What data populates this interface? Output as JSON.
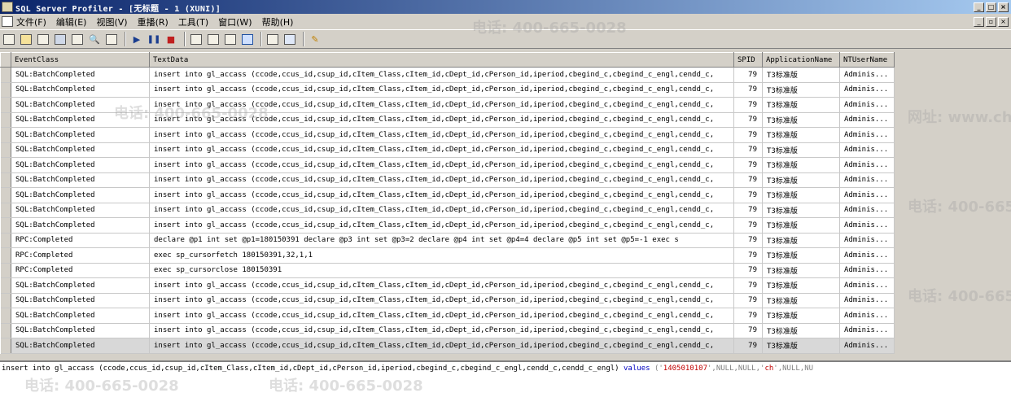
{
  "window": {
    "title": "SQL Server Profiler - [无标题 - 1 (XUNI)]"
  },
  "menu": [
    {
      "label": "文件(F)"
    },
    {
      "label": "编辑(E)"
    },
    {
      "label": "视图(V)"
    },
    {
      "label": "重播(R)"
    },
    {
      "label": "工具(T)"
    },
    {
      "label": "窗口(W)"
    },
    {
      "label": "帮助(H)"
    }
  ],
  "toolbar": {
    "buttons": [
      {
        "icon": "new-trace-icon"
      },
      {
        "icon": "open-file-icon"
      },
      {
        "icon": "open-table-icon"
      },
      {
        "icon": "save-icon"
      },
      {
        "icon": "properties-icon"
      },
      {
        "icon": "find-icon"
      },
      {
        "icon": "clear-icon"
      },
      {
        "icon": "start-icon"
      },
      {
        "icon": "pause-icon"
      },
      {
        "icon": "stop-icon"
      },
      {
        "icon": "step-icon"
      },
      {
        "icon": "run-to-cursor-icon"
      },
      {
        "icon": "toggle-bookmark-icon"
      },
      {
        "icon": "auto-scroll-icon"
      },
      {
        "icon": "activity-monitor-icon"
      },
      {
        "icon": "perfmon-icon"
      },
      {
        "icon": "help-icon"
      }
    ]
  },
  "grid": {
    "columns": [
      "EventClass",
      "TextData",
      "SPID",
      "ApplicationName",
      "NTUserName"
    ],
    "rows": [
      {
        "event": "SQL:BatchCompleted",
        "text": "insert into gl_accass (ccode,ccus_id,csup_id,cItem_Class,cItem_id,cDept_id,cPerson_id,iperiod,cbegind_c,cbegind_c_engl,cendd_c,",
        "spid": "79",
        "app": "T3标准版",
        "user": "Adminis..."
      },
      {
        "event": "SQL:BatchCompleted",
        "text": "insert into gl_accass (ccode,ccus_id,csup_id,cItem_Class,cItem_id,cDept_id,cPerson_id,iperiod,cbegind_c,cbegind_c_engl,cendd_c,",
        "spid": "79",
        "app": "T3标准版",
        "user": "Adminis..."
      },
      {
        "event": "SQL:BatchCompleted",
        "text": "insert into gl_accass (ccode,ccus_id,csup_id,cItem_Class,cItem_id,cDept_id,cPerson_id,iperiod,cbegind_c,cbegind_c_engl,cendd_c,",
        "spid": "79",
        "app": "T3标准版",
        "user": "Adminis..."
      },
      {
        "event": "SQL:BatchCompleted",
        "text": "insert into gl_accass (ccode,ccus_id,csup_id,cItem_Class,cItem_id,cDept_id,cPerson_id,iperiod,cbegind_c,cbegind_c_engl,cendd_c,",
        "spid": "79",
        "app": "T3标准版",
        "user": "Adminis..."
      },
      {
        "event": "SQL:BatchCompleted",
        "text": "insert into gl_accass (ccode,ccus_id,csup_id,cItem_Class,cItem_id,cDept_id,cPerson_id,iperiod,cbegind_c,cbegind_c_engl,cendd_c,",
        "spid": "79",
        "app": "T3标准版",
        "user": "Adminis..."
      },
      {
        "event": "SQL:BatchCompleted",
        "text": "insert into gl_accass (ccode,ccus_id,csup_id,cItem_Class,cItem_id,cDept_id,cPerson_id,iperiod,cbegind_c,cbegind_c_engl,cendd_c,",
        "spid": "79",
        "app": "T3标准版",
        "user": "Adminis..."
      },
      {
        "event": "SQL:BatchCompleted",
        "text": "insert into gl_accass (ccode,ccus_id,csup_id,cItem_Class,cItem_id,cDept_id,cPerson_id,iperiod,cbegind_c,cbegind_c_engl,cendd_c,",
        "spid": "79",
        "app": "T3标准版",
        "user": "Adminis..."
      },
      {
        "event": "SQL:BatchCompleted",
        "text": "insert into gl_accass (ccode,ccus_id,csup_id,cItem_Class,cItem_id,cDept_id,cPerson_id,iperiod,cbegind_c,cbegind_c_engl,cendd_c,",
        "spid": "79",
        "app": "T3标准版",
        "user": "Adminis..."
      },
      {
        "event": "SQL:BatchCompleted",
        "text": "insert into gl_accass (ccode,ccus_id,csup_id,cItem_Class,cItem_id,cDept_id,cPerson_id,iperiod,cbegind_c,cbegind_c_engl,cendd_c,",
        "spid": "79",
        "app": "T3标准版",
        "user": "Adminis..."
      },
      {
        "event": "SQL:BatchCompleted",
        "text": "insert into gl_accass (ccode,ccus_id,csup_id,cItem_Class,cItem_id,cDept_id,cPerson_id,iperiod,cbegind_c,cbegind_c_engl,cendd_c,",
        "spid": "79",
        "app": "T3标准版",
        "user": "Adminis..."
      },
      {
        "event": "SQL:BatchCompleted",
        "text": "insert into gl_accass (ccode,ccus_id,csup_id,cItem_Class,cItem_id,cDept_id,cPerson_id,iperiod,cbegind_c,cbegind_c_engl,cendd_c,",
        "spid": "79",
        "app": "T3标准版",
        "user": "Adminis..."
      },
      {
        "event": "RPC:Completed",
        "text": "declare @p1 int  set @p1=180150391  declare @p3 int  set @p3=2  declare @p4 int  set @p4=4  declare @p5 int  set @p5=-1  exec s",
        "spid": "79",
        "app": "T3标准版",
        "user": "Adminis..."
      },
      {
        "event": "RPC:Completed",
        "text": "exec sp_cursorfetch 180150391,32,1,1",
        "spid": "79",
        "app": "T3标准版",
        "user": "Adminis..."
      },
      {
        "event": "RPC:Completed",
        "text": "exec sp_cursorclose 180150391",
        "spid": "79",
        "app": "T3标准版",
        "user": "Adminis..."
      },
      {
        "event": "SQL:BatchCompleted",
        "text": "insert into gl_accass (ccode,ccus_id,csup_id,cItem_Class,cItem_id,cDept_id,cPerson_id,iperiod,cbegind_c,cbegind_c_engl,cendd_c,",
        "spid": "79",
        "app": "T3标准版",
        "user": "Adminis..."
      },
      {
        "event": "SQL:BatchCompleted",
        "text": "insert into gl_accass (ccode,ccus_id,csup_id,cItem_Class,cItem_id,cDept_id,cPerson_id,iperiod,cbegind_c,cbegind_c_engl,cendd_c,",
        "spid": "79",
        "app": "T3标准版",
        "user": "Adminis..."
      },
      {
        "event": "SQL:BatchCompleted",
        "text": "insert into gl_accass (ccode,ccus_id,csup_id,cItem_Class,cItem_id,cDept_id,cPerson_id,iperiod,cbegind_c,cbegind_c_engl,cendd_c,",
        "spid": "79",
        "app": "T3标准版",
        "user": "Adminis..."
      },
      {
        "event": "SQL:BatchCompleted",
        "text": "insert into gl_accass (ccode,ccus_id,csup_id,cItem_Class,cItem_id,cDept_id,cPerson_id,iperiod,cbegind_c,cbegind_c_engl,cendd_c,",
        "spid": "79",
        "app": "T3标准版",
        "user": "Adminis..."
      },
      {
        "event": "SQL:BatchCompleted",
        "text": "insert into gl_accass (ccode,ccus_id,csup_id,cItem_Class,cItem_id,cDept_id,cPerson_id,iperiod,cbegind_c,cbegind_c_engl,cendd_c,",
        "spid": "79",
        "app": "T3标准版",
        "user": "Adminis...",
        "selected": true
      }
    ]
  },
  "detail": {
    "prefix": "insert into gl_accass (ccode,ccus_id,csup_id,cItem_Class,cItem_id,cDept_id,cPerson_id,iperiod,cbegind_c,cbegind_c_engl,cendd_c,cendd_c_engl)",
    "keyword": "values",
    "open": " ('",
    "string1": "1405010107",
    "mid": "',NULL,NULL,'",
    "string2": "ch",
    "suffix": "',NULL,NU"
  },
  "watermarks": [
    {
      "text": "电话: 400-665-0028"
    },
    {
      "text": "网址: www.chanjet.net"
    }
  ]
}
